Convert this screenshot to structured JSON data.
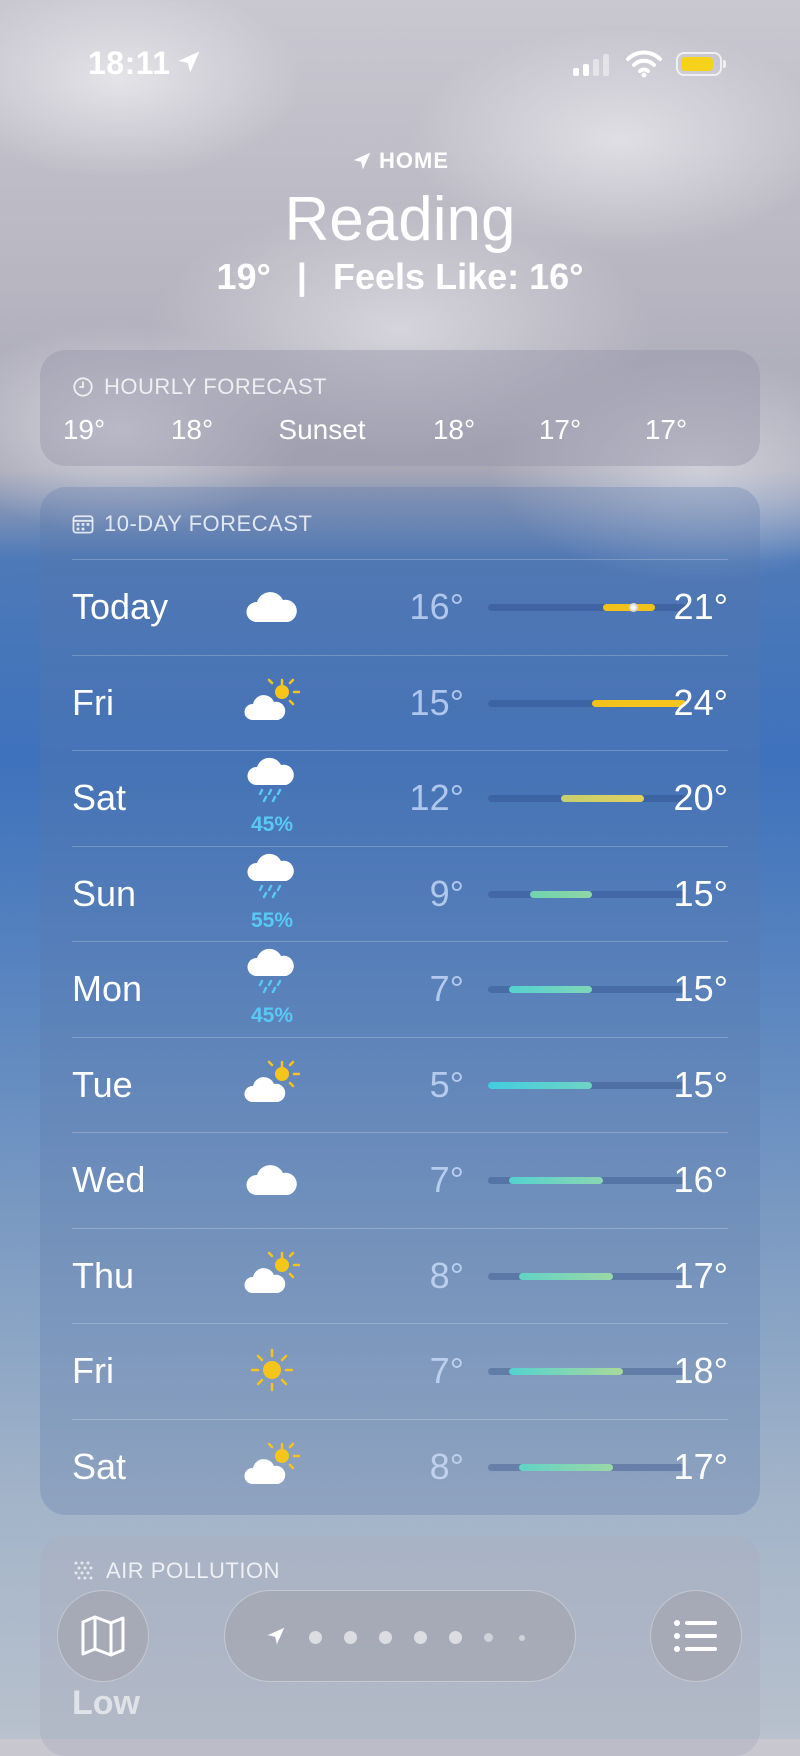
{
  "status_bar": {
    "time": "18:11",
    "battery_color": "#f7d21a"
  },
  "header": {
    "home_label": "HOME",
    "city": "Reading",
    "temperature": "19°",
    "separator": "|",
    "feels_like": "Feels Like: 16°"
  },
  "hourly": {
    "title": "HOURLY FORECAST",
    "items": [
      "19°",
      "18°",
      "Sunset",
      "18°",
      "17°",
      "17°"
    ]
  },
  "daily": {
    "title": "10-DAY FORECAST",
    "range_min": 5,
    "range_max": 24,
    "rows": [
      {
        "day": "Today",
        "icon": "cloud-icon",
        "precip": "",
        "low": "16°",
        "high": "21°",
        "low_val": 16,
        "high_val": 21,
        "current_val": 19,
        "color_from": "#f2c21b",
        "color_to": "#f2c21b"
      },
      {
        "day": "Fri",
        "icon": "partly-sunny-icon",
        "precip": "",
        "low": "15°",
        "high": "24°",
        "low_val": 15,
        "high_val": 24,
        "color_from": "#f2c21b",
        "color_to": "#f7c51e"
      },
      {
        "day": "Sat",
        "icon": "rain-icon",
        "precip": "45%",
        "low": "12°",
        "high": "20°",
        "low_val": 12,
        "high_val": 20,
        "color_from": "#c6cf6f",
        "color_to": "#e1d060"
      },
      {
        "day": "Sun",
        "icon": "rain-icon",
        "precip": "55%",
        "low": "9°",
        "high": "15°",
        "low_val": 9,
        "high_val": 15,
        "color_from": "#6fd3b0",
        "color_to": "#8fd6a4"
      },
      {
        "day": "Mon",
        "icon": "rain-icon",
        "precip": "45%",
        "low": "7°",
        "high": "15°",
        "low_val": 7,
        "high_val": 15,
        "color_from": "#55d2cf",
        "color_to": "#7ed6b8"
      },
      {
        "day": "Tue",
        "icon": "partly-sunny-icon",
        "precip": "",
        "low": "5°",
        "high": "15°",
        "low_val": 5,
        "high_val": 15,
        "color_from": "#42cde0",
        "color_to": "#6fd4c3"
      },
      {
        "day": "Wed",
        "icon": "cloud-icon",
        "precip": "",
        "low": "7°",
        "high": "16°",
        "low_val": 7,
        "high_val": 16,
        "color_from": "#55d2cf",
        "color_to": "#8ad6b1"
      },
      {
        "day": "Thu",
        "icon": "partly-sunny-icon",
        "precip": "",
        "low": "8°",
        "high": "17°",
        "low_val": 8,
        "high_val": 17,
        "color_from": "#62d3c5",
        "color_to": "#9bd8a6"
      },
      {
        "day": "Fri",
        "icon": "sun-icon",
        "precip": "",
        "low": "7°",
        "high": "18°",
        "low_val": 7,
        "high_val": 18,
        "color_from": "#55d2cf",
        "color_to": "#a9d99a"
      },
      {
        "day": "Sat",
        "icon": "partly-sunny-icon",
        "precip": "",
        "low": "8°",
        "high": "17°",
        "low_val": 8,
        "high_val": 17,
        "color_from": "#62d3c5",
        "color_to": "#9bd8a6"
      }
    ]
  },
  "air": {
    "title": "AIR POLLUTION",
    "value": "Low"
  },
  "nav": {
    "map_icon": "map-icon",
    "list_icon": "list-icon",
    "page_count": 7,
    "current_page": 0
  }
}
